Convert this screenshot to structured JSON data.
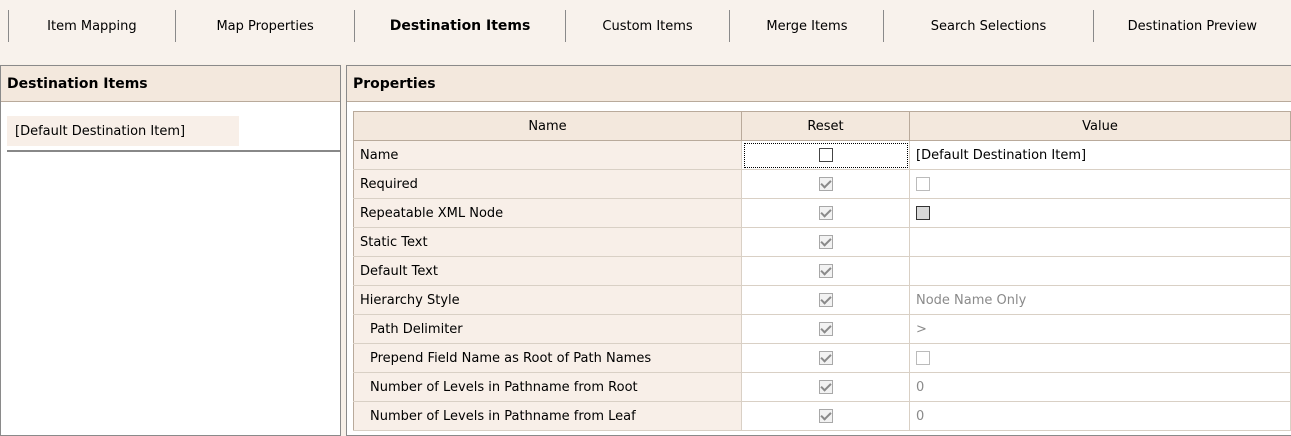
{
  "tabs": [
    {
      "label": "Item Mapping",
      "active": false
    },
    {
      "label": "Map Properties",
      "active": false
    },
    {
      "label": "Destination Items",
      "active": true
    },
    {
      "label": "Custom Items",
      "active": false
    },
    {
      "label": "Merge Items",
      "active": false
    },
    {
      "label": "Search Selections",
      "active": false
    },
    {
      "label": "Destination Preview",
      "active": false
    }
  ],
  "left_pane": {
    "title": "Destination Items",
    "items": [
      "[Default Destination Item]"
    ],
    "selected": "[Default Destination Item]"
  },
  "properties": {
    "title": "Properties",
    "columns": {
      "name": "Name",
      "reset": "Reset",
      "value": "Value"
    },
    "rows": [
      {
        "name": "Name",
        "reset": "unchecked",
        "value_type": "text",
        "value": "[Default Destination Item]",
        "indent": false
      },
      {
        "name": "Required",
        "reset": "checked-disabled",
        "value_type": "checkbox",
        "value": "unchecked-disabled",
        "indent": false
      },
      {
        "name": "Repeatable XML Node",
        "reset": "checked-disabled",
        "value_type": "checkbox",
        "value": "indeterminate",
        "indent": false
      },
      {
        "name": "Static Text",
        "reset": "checked-disabled",
        "value_type": "text",
        "value": "",
        "indent": false
      },
      {
        "name": "Default Text",
        "reset": "checked-disabled",
        "value_type": "text",
        "value": "",
        "indent": false
      },
      {
        "name": "Hierarchy Style",
        "reset": "checked-disabled",
        "value_type": "text-disabled",
        "value": "Node Name Only",
        "indent": false
      },
      {
        "name": "Path Delimiter",
        "reset": "checked-disabled",
        "value_type": "text-disabled",
        "value": ">",
        "indent": true
      },
      {
        "name": "Prepend Field Name as Root of Path Names",
        "reset": "checked-disabled",
        "value_type": "checkbox",
        "value": "unchecked-disabled",
        "indent": true
      },
      {
        "name": "Number of Levels in Pathname from Root",
        "reset": "checked-disabled",
        "value_type": "text-disabled",
        "value": "0",
        "indent": true
      },
      {
        "name": "Number of Levels in Pathname from Leaf",
        "reset": "checked-disabled",
        "value_type": "text-disabled",
        "value": "0",
        "indent": true
      }
    ]
  },
  "colors": {
    "panel_header": "#f3e8dd",
    "name_cell": "#f8efe8",
    "disabled_text": "#8a8a8a"
  }
}
